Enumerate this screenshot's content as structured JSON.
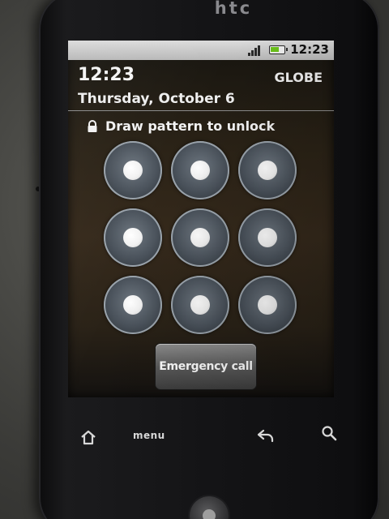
{
  "device": {
    "brand": "htc"
  },
  "statusbar": {
    "time": "12:23",
    "battery_color": "#6bc21a"
  },
  "lockscreen": {
    "clock": "12:23",
    "carrier": "GLOBE",
    "date": "Thursday, October 6",
    "instruction": "Draw pattern to unlock",
    "emergency_label": "Emergency call"
  },
  "pattern": {
    "rows": 3,
    "cols": 3
  },
  "hardware_keys": {
    "menu_label": "menu"
  }
}
